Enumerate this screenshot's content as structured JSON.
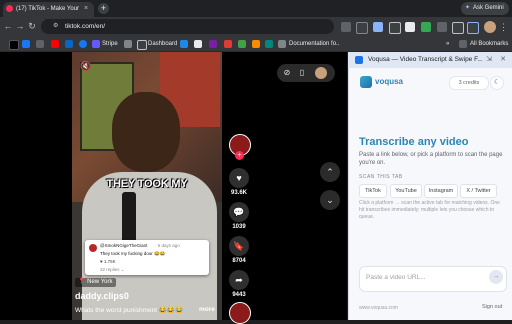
{
  "browser": {
    "tab_title": "(17) TikTok - Make Your Day",
    "tab_close": "×",
    "new_tab": "+",
    "gemini_label": "Ask Gemini",
    "gemini_icon": "✦",
    "url": "tiktok.com/en/",
    "back": "←",
    "forward": "→",
    "reload": "↻",
    "star": "☆",
    "kebab": "⋮"
  },
  "bookmarks": {
    "stripe": "Stripe",
    "dashboard": "Dashboard",
    "documentation": "Documentation fo...",
    "all": "All Bookmarks",
    "chevron": "»"
  },
  "video": {
    "caption_a": "THEY ",
    "caption_b": "TOOK",
    "caption_c": " MY",
    "comment": {
      "user": "@SmokNGigeTheGiant",
      "time": "· 5 days ago",
      "text": "They took my fucking door 😂😂",
      "likes": "♥ 1.75K",
      "reply": "32 replies ⌄"
    },
    "location": "📍 New York",
    "handle": "daddy.clips0",
    "description": "Whats the worst punishment 😂😂😂",
    "more": "more"
  },
  "actions": {
    "likes": "93.6K",
    "comments": "1039",
    "saves": "8704",
    "shares": "9443",
    "plus": "+"
  },
  "panel": {
    "header_title": "Voqusa — Video Transcript & Swipe F...",
    "logo": "voqusa",
    "credits": "3 credits",
    "title": "Transcribe any video",
    "subtitle": "Paste a link below, or pick a platform to scan the page you're on.",
    "scan_label": "SCAN THIS TAB",
    "chips": [
      "TikTok",
      "YouTube",
      "Instagram",
      "X / Twitter"
    ],
    "help": "Click a platform → scan the active tab for matching videos. One hit transcribes immediately; multiple lets you choose which to queue.",
    "input_placeholder": "Paste a video URL...",
    "footer_left": "www.voqusa.com",
    "footer_right": "Sign out"
  },
  "colors": {
    "tiktok_red": "#fe2c55",
    "panel_accent": "#2b86b5"
  }
}
